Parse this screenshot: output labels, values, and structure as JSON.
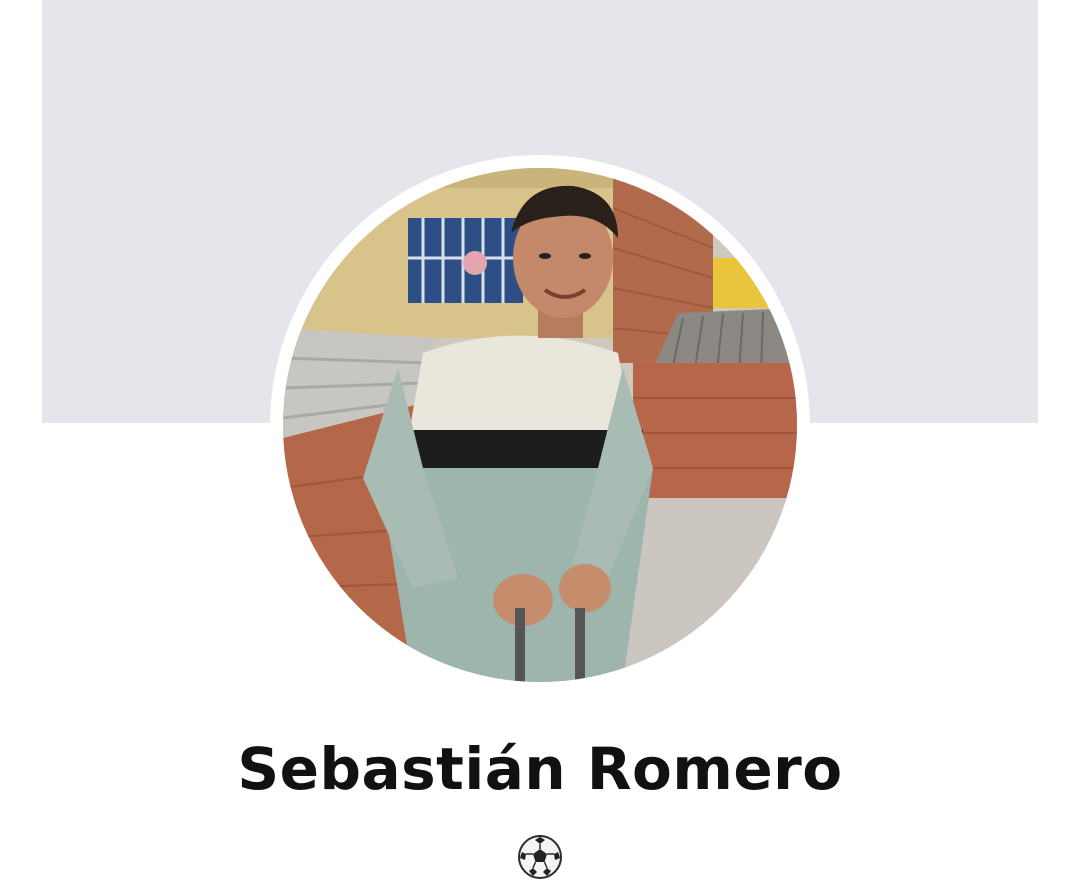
{
  "profile": {
    "name": "Sebastián Romero",
    "bio_icon": "soccer-ball-icon"
  },
  "colors": {
    "cover_background": "#e4e6eb",
    "page_background": "#ffffff",
    "name_text": "#111111"
  }
}
